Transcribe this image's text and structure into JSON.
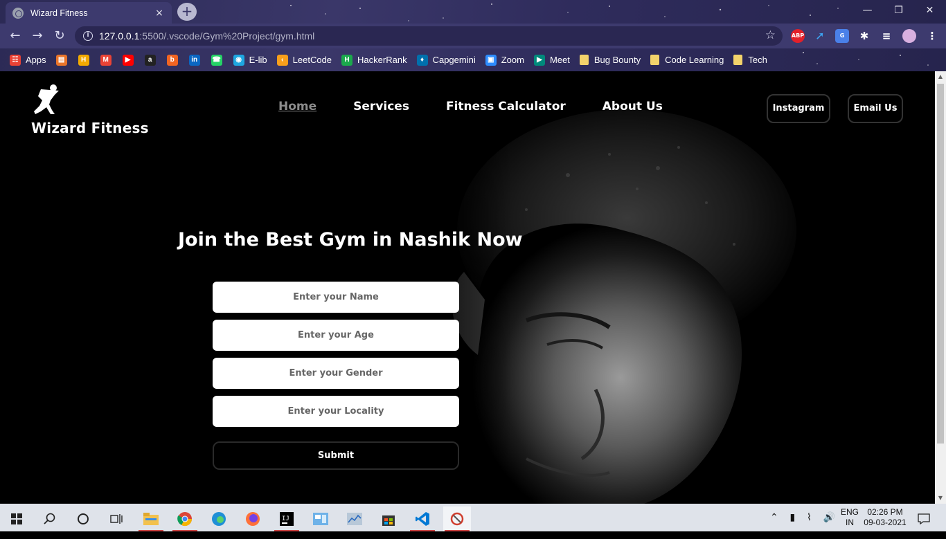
{
  "browser": {
    "tab_title": "Wizard Fitness",
    "tab_close": "×",
    "new_tab": "+",
    "url_host": "127.0.0.1",
    "url_rest": ":5500/.vscode/Gym%20Project/gym.html",
    "extension_abp": "ABP",
    "bookmarks": [
      {
        "label": "Apps",
        "icon": "apps-grid-icon",
        "color": "#e94235"
      },
      {
        "label": "",
        "icon": "inbox-icon",
        "color": "#e8742a"
      },
      {
        "label": "",
        "icon": "h-icon",
        "color": "#f2a900"
      },
      {
        "label": "",
        "icon": "gmail-icon",
        "color": "#ea4335"
      },
      {
        "label": "",
        "icon": "youtube-icon",
        "color": "#ff0000"
      },
      {
        "label": "",
        "icon": "amazon-icon",
        "color": "#222222"
      },
      {
        "label": "",
        "icon": "b-icon",
        "color": "#f26522"
      },
      {
        "label": "",
        "icon": "linkedin-icon",
        "color": "#0a66c2"
      },
      {
        "label": "",
        "icon": "whatsapp-icon",
        "color": "#25d366"
      },
      {
        "label": "E-lib",
        "icon": "elib-icon",
        "color": "#1ea7e0"
      },
      {
        "label": "LeetCode",
        "icon": "leetcode-icon",
        "color": "#f89f1b"
      },
      {
        "label": "HackerRank",
        "icon": "hackerrank-icon",
        "color": "#1ba94c"
      },
      {
        "label": "Capgemini",
        "icon": "capgemini-icon",
        "color": "#0070ad"
      },
      {
        "label": "Zoom",
        "icon": "zoom-icon",
        "color": "#2d8cff"
      },
      {
        "label": "Meet",
        "icon": "meet-icon",
        "color": "#00897b"
      },
      {
        "label": "Bug Bounty",
        "icon": "folder-icon",
        "color": "#f3d36b"
      },
      {
        "label": "Code Learning",
        "icon": "folder-icon",
        "color": "#f3d36b"
      },
      {
        "label": "Tech",
        "icon": "folder-icon",
        "color": "#f3d36b"
      }
    ]
  },
  "site": {
    "brand": "Wizard Fitness",
    "nav": [
      {
        "label": "Home",
        "active": true
      },
      {
        "label": "Services",
        "active": false
      },
      {
        "label": "Fitness Calculator",
        "active": false
      },
      {
        "label": "About Us",
        "active": false
      }
    ],
    "instagram_label": "Instagram",
    "email_label": "Email Us",
    "headline": "Join the Best Gym in Nashik Now",
    "form": {
      "name_placeholder": "Enter your Name",
      "age_placeholder": "Enter your Age",
      "gender_placeholder": "Enter your Gender",
      "locality_placeholder": "Enter your Locality",
      "submit_label": "Submit"
    }
  },
  "taskbar": {
    "lang_top": "ENG",
    "lang_bottom": "IN",
    "time": "02:26 PM",
    "date": "09-03-2021"
  },
  "colors": {
    "chrome_bg": "#3d3a6e",
    "nav_active": "#8c8c8c",
    "page_bg": "#000000",
    "taskbar_bg": "#dfe3ea"
  }
}
